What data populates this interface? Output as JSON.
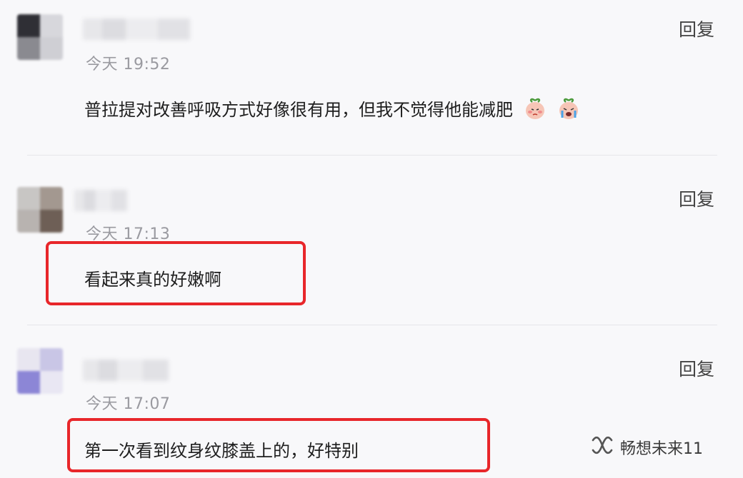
{
  "comments": [
    {
      "time": "今天 19:52",
      "reply_label": "回复",
      "text": "普拉提对改善呼吸方式好像很有用，但我不觉得他能减肥",
      "emojis": [
        "peach-blush-emoji",
        "peach-crying-emoji"
      ],
      "highlighted": false
    },
    {
      "time": "今天 17:13",
      "reply_label": "回复",
      "text": "看起来真的好嫩啊",
      "highlighted": true
    },
    {
      "time": "今天 17:07",
      "reply_label": "回复",
      "text": "第一次看到纹身纹膝盖上的，好特别",
      "highlighted": true
    }
  ],
  "watermark": {
    "icon": "wechat-channel-icon",
    "text": "畅想未来11"
  },
  "colors": {
    "highlight": "#e8262a",
    "time": "#9a9aa0",
    "text": "#1e1e1e"
  }
}
